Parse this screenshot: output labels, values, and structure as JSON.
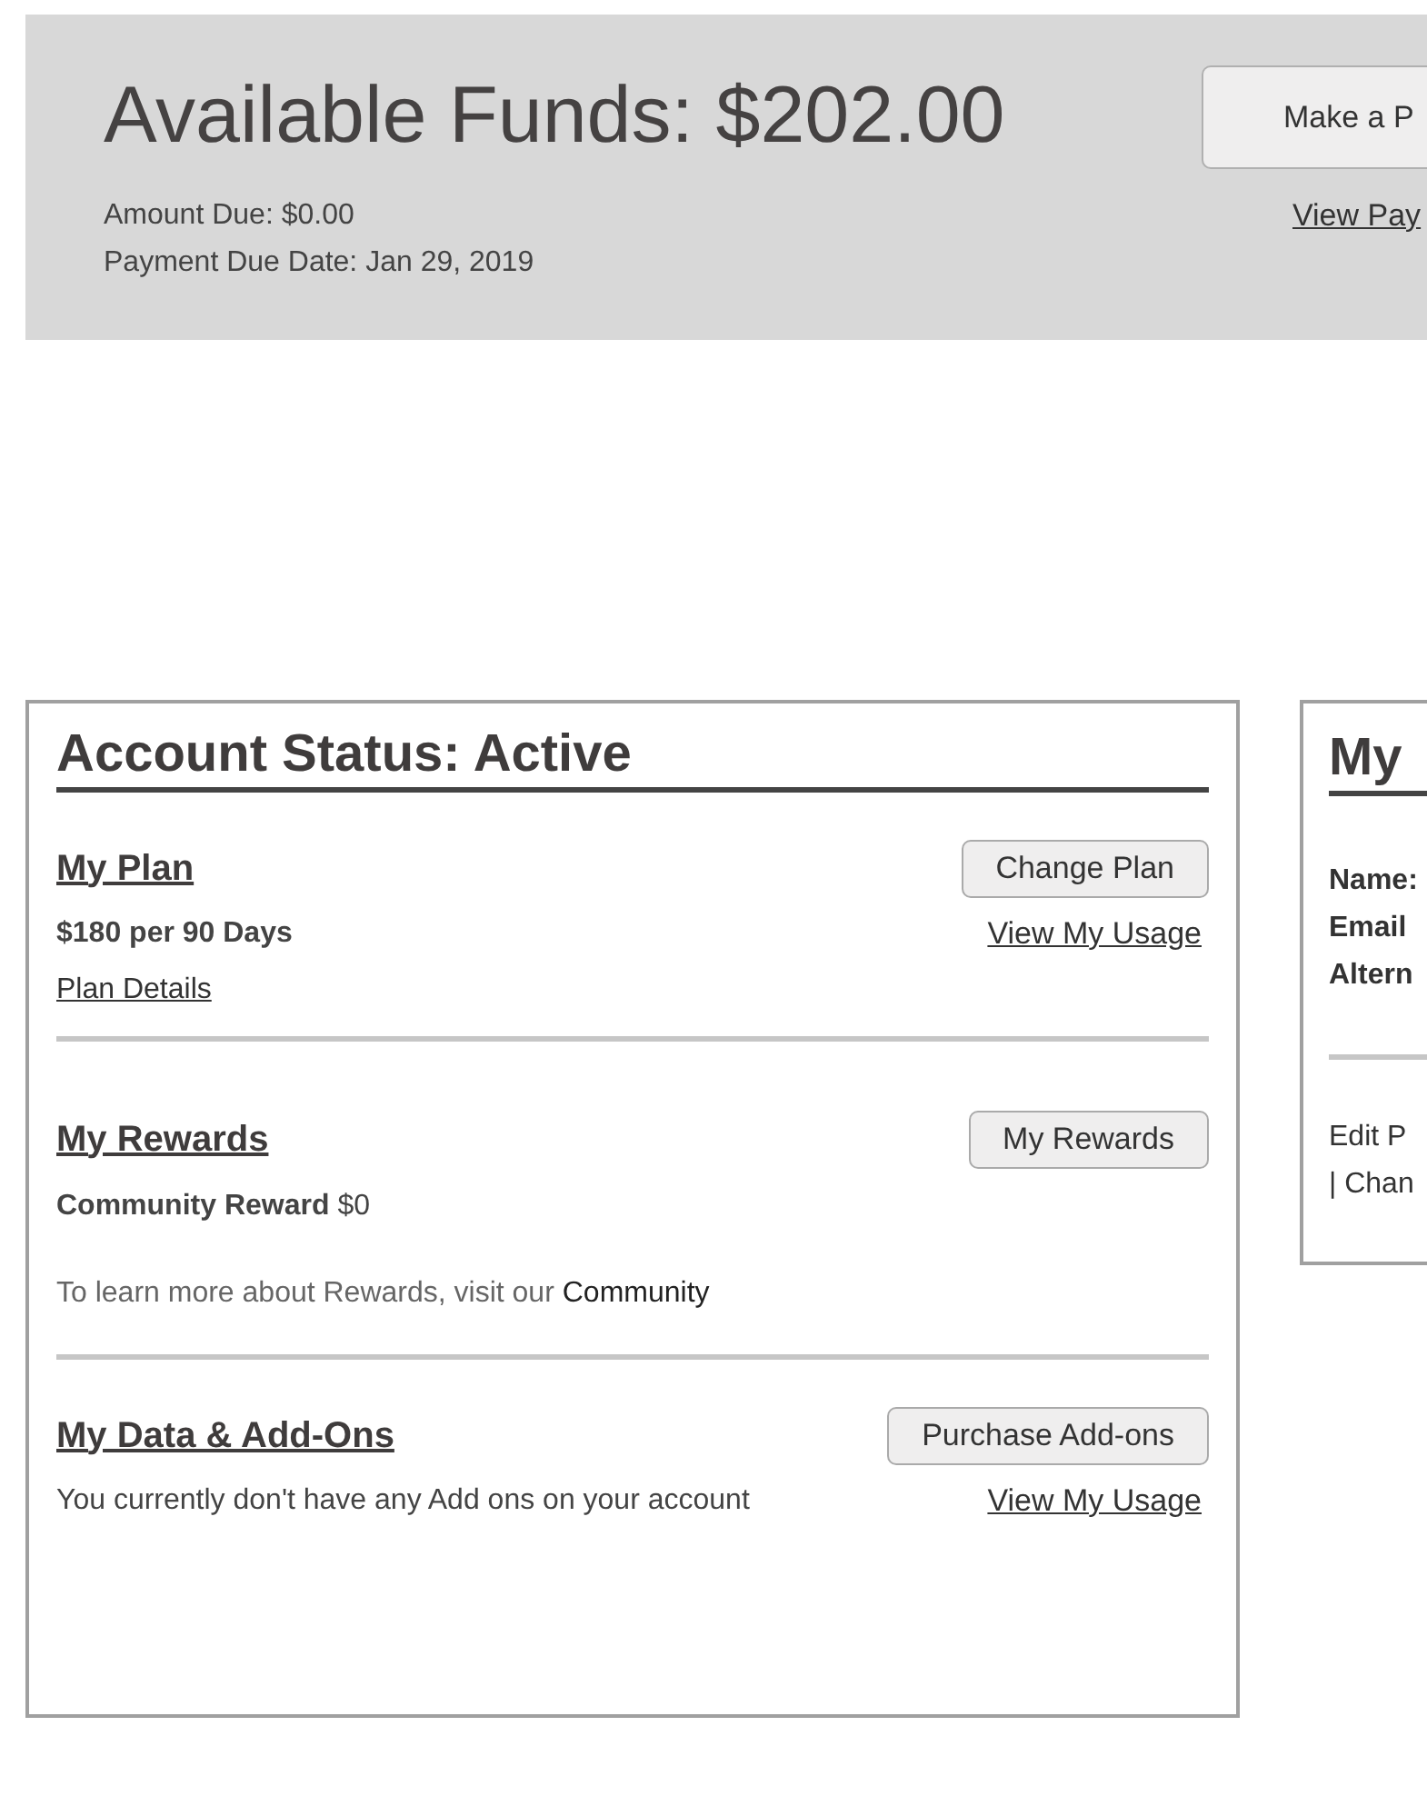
{
  "funds": {
    "title": "Available Funds: $202.00",
    "amount_due": "Amount Due: $0.00",
    "due_date": "Payment Due Date: Jan 29, 2019",
    "button": "Make a P",
    "link": "View Pay"
  },
  "account": {
    "title": "Account Status: Active",
    "sections": [
      {
        "kind": "plan",
        "heading": "My Plan",
        "button": "Change Plan",
        "detail": "$180 per 90 Days",
        "link": "View My Usage",
        "sublink": "Plan Details"
      },
      {
        "kind": "rewards",
        "heading": "My Rewards",
        "button": "My Rewards",
        "detail": "**Community Reward** $0",
        "note": "To learn more about Rewards, visit our",
        "note_link": "Community"
      },
      {
        "kind": "addons",
        "heading": "My Data & Add-Ons",
        "button": "Purchase Add-ons",
        "detail": "You currently don't have any Add ons on your account",
        "link": "View My Usage"
      }
    ]
  },
  "profile": {
    "title": "My",
    "fields": [
      "Name:",
      "Email",
      "Altern"
    ],
    "links": [
      "Edit P",
      "| Chan"
    ]
  }
}
